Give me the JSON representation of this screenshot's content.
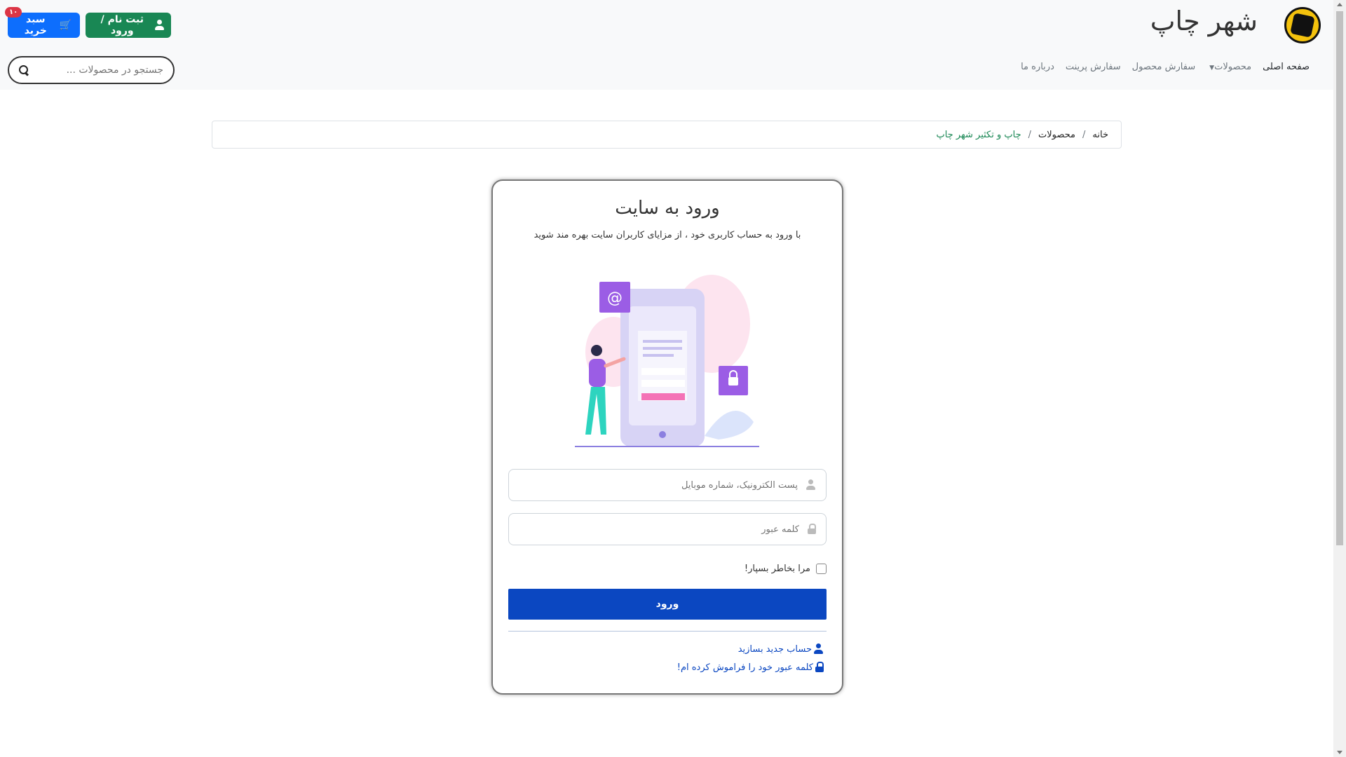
{
  "header": {
    "site_title": "شهر چاپ",
    "login_button": "ثبت نام / ورود",
    "cart_button": "سبد خرید",
    "cart_badge": "۱۰"
  },
  "nav": {
    "items": [
      {
        "label": "صفحه اصلی",
        "active": true
      },
      {
        "label": "محصولات",
        "dropdown": true
      },
      {
        "label": "سفارش محصول"
      },
      {
        "label": "سفارش پرینت"
      },
      {
        "label": "درباره ما"
      }
    ]
  },
  "search": {
    "placeholder": "جستجو در محصولات ..."
  },
  "breadcrumb": {
    "items": [
      "خانه",
      "محصولات",
      "چاپ و تکثیر شهر چاپ"
    ],
    "separator": "/"
  },
  "login": {
    "title": "ورود به سایت",
    "subtitle": "با ورود به حساب کاربری خود ، از مزایای کاربران سایت بهره مند شوید",
    "email_placeholder": "پست الکترونیک، شماره موبایل",
    "password_placeholder": "کلمه عبور",
    "remember_label": "مرا بخاطر بسپار!",
    "submit_label": "ورود",
    "register_link": "حساب جدید بسازید",
    "forgot_link": "کلمه عبور خود را فراموش کرده ام!"
  },
  "colors": {
    "primary": "#0b47c1",
    "success": "#198754",
    "cart_blue": "#0d6efd",
    "badge_red": "#dc3545",
    "illustration_purple": "#8b5cf6"
  }
}
